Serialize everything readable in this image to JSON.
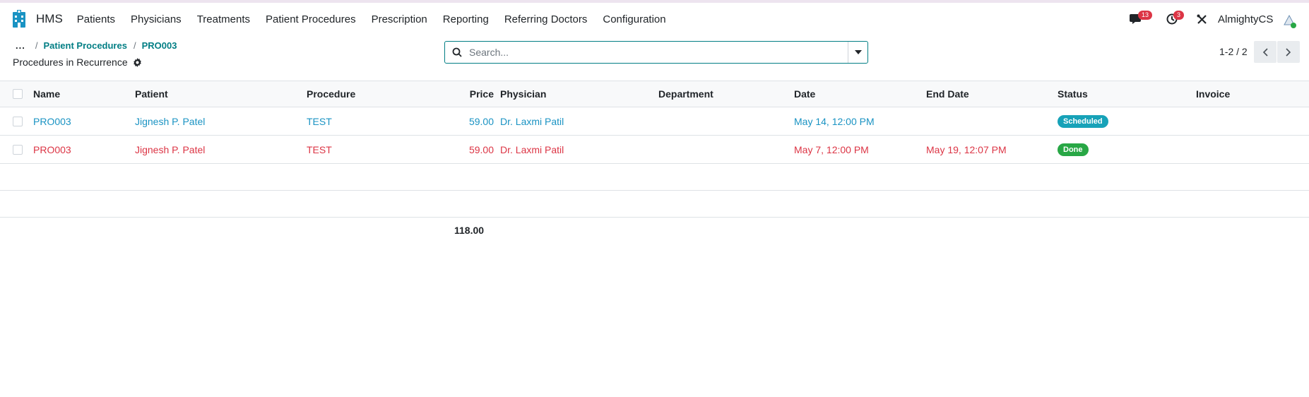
{
  "app": {
    "name": "HMS"
  },
  "menu": [
    "Patients",
    "Physicians",
    "Treatments",
    "Patient Procedures",
    "Prescription",
    "Reporting",
    "Referring Doctors",
    "Configuration"
  ],
  "nav_right": {
    "messages_count": "13",
    "activities_count": "3",
    "username": "AlmightyCS",
    "icons": [
      "chat-icon",
      "clock-icon",
      "tools-icon",
      "avatar"
    ]
  },
  "breadcrumb": {
    "dots": "...",
    "sep": "/",
    "items": [
      "Patient Procedures",
      "PRO003"
    ]
  },
  "view_title": "Procedures in Recurrence",
  "search": {
    "placeholder": "Search..."
  },
  "pager": {
    "text": "1-2 / 2"
  },
  "table": {
    "columns": [
      "Name",
      "Patient",
      "Procedure",
      "Price",
      "Physician",
      "Department",
      "Date",
      "End Date",
      "Status",
      "Invoice"
    ],
    "rows": [
      {
        "name": "PRO003",
        "patient": "Jignesh P. Patel",
        "procedure": "TEST",
        "price": "59.00",
        "physician": "Dr. Laxmi Patil",
        "department": "",
        "date": "May 14, 12:00 PM",
        "end_date": "",
        "status": "Scheduled",
        "invoice": ""
      },
      {
        "name": "PRO003",
        "patient": "Jignesh P. Patel",
        "procedure": "TEST",
        "price": "59.00",
        "physician": "Dr. Laxmi Patil",
        "department": "",
        "date": "May 7, 12:00 PM",
        "end_date": "May 19, 12:07 PM",
        "status": "Done",
        "invoice": ""
      }
    ],
    "total_price": "118.00"
  },
  "colors": {
    "brand": "#017e84",
    "row_scheduled": "#1a93c3",
    "row_done": "#dc3545",
    "badge_scheduled": "#17a2b8",
    "badge_done": "#28a745",
    "badge_count": "#dc3545"
  }
}
